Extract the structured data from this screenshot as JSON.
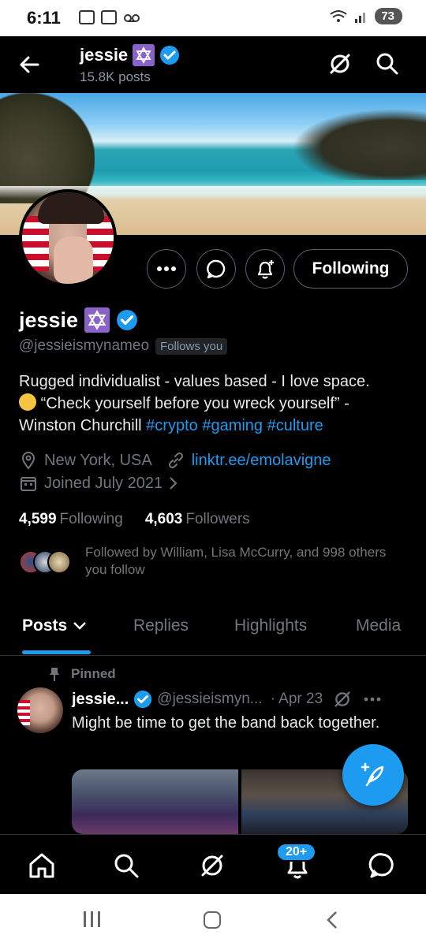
{
  "status_bar": {
    "time": "6:11",
    "battery": "73"
  },
  "header": {
    "title": "jessie",
    "subtitle": "15.8K posts"
  },
  "profile": {
    "name": "jessie",
    "handle": "@jessieismynameo",
    "follows_you": "Follows you",
    "follow_button": "Following",
    "bio_line1": "Rugged individualist - values based - I love space.",
    "bio_line2_pre": "“Check yourself before you wreck yourself” -",
    "bio_line3_pre": "Winston Churchill",
    "hashtags": [
      "#crypto",
      "#gaming",
      "#culture"
    ],
    "location": "New York, USA",
    "link": "linktr.ee/emolavigne",
    "joined": "Joined July 2021",
    "following_count": "4,599",
    "following_label": "Following",
    "followers_count": "4,603",
    "followers_label": "Followers",
    "followed_by": "Followed by William, Lisa McCurry, and 998 others you follow"
  },
  "tabs": [
    "Posts",
    "Replies",
    "Highlights",
    "Media"
  ],
  "post": {
    "pinned_label": "Pinned",
    "name": "jessie...",
    "handle": "@jessieismyn...",
    "date": "· Apr 23",
    "text": "Might be time to get the band back together."
  },
  "bottom_nav": {
    "notifications_badge": "20+"
  },
  "colors": {
    "accent": "#1d9bf0",
    "background": "#000000",
    "muted": "#71767b",
    "badge_purple": "#8a63c9"
  }
}
